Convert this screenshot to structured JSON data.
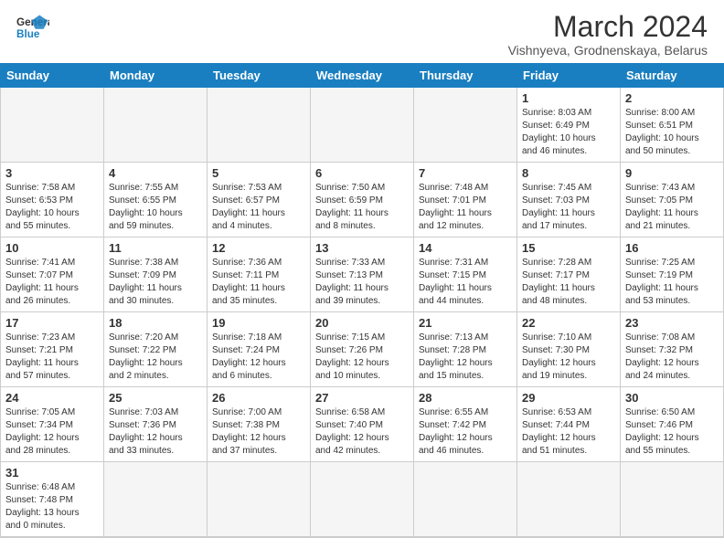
{
  "header": {
    "logo_general": "General",
    "logo_blue": "Blue",
    "month_title": "March 2024",
    "location": "Vishnyeva, Grodnenskaya, Belarus"
  },
  "weekdays": [
    "Sunday",
    "Monday",
    "Tuesday",
    "Wednesday",
    "Thursday",
    "Friday",
    "Saturday"
  ],
  "weeks": [
    [
      {
        "day": "",
        "info": ""
      },
      {
        "day": "",
        "info": ""
      },
      {
        "day": "",
        "info": ""
      },
      {
        "day": "",
        "info": ""
      },
      {
        "day": "",
        "info": ""
      },
      {
        "day": "1",
        "info": "Sunrise: 8:03 AM\nSunset: 6:49 PM\nDaylight: 10 hours\nand 46 minutes."
      },
      {
        "day": "2",
        "info": "Sunrise: 8:00 AM\nSunset: 6:51 PM\nDaylight: 10 hours\nand 50 minutes."
      }
    ],
    [
      {
        "day": "3",
        "info": "Sunrise: 7:58 AM\nSunset: 6:53 PM\nDaylight: 10 hours\nand 55 minutes."
      },
      {
        "day": "4",
        "info": "Sunrise: 7:55 AM\nSunset: 6:55 PM\nDaylight: 10 hours\nand 59 minutes."
      },
      {
        "day": "5",
        "info": "Sunrise: 7:53 AM\nSunset: 6:57 PM\nDaylight: 11 hours\nand 4 minutes."
      },
      {
        "day": "6",
        "info": "Sunrise: 7:50 AM\nSunset: 6:59 PM\nDaylight: 11 hours\nand 8 minutes."
      },
      {
        "day": "7",
        "info": "Sunrise: 7:48 AM\nSunset: 7:01 PM\nDaylight: 11 hours\nand 12 minutes."
      },
      {
        "day": "8",
        "info": "Sunrise: 7:45 AM\nSunset: 7:03 PM\nDaylight: 11 hours\nand 17 minutes."
      },
      {
        "day": "9",
        "info": "Sunrise: 7:43 AM\nSunset: 7:05 PM\nDaylight: 11 hours\nand 21 minutes."
      }
    ],
    [
      {
        "day": "10",
        "info": "Sunrise: 7:41 AM\nSunset: 7:07 PM\nDaylight: 11 hours\nand 26 minutes."
      },
      {
        "day": "11",
        "info": "Sunrise: 7:38 AM\nSunset: 7:09 PM\nDaylight: 11 hours\nand 30 minutes."
      },
      {
        "day": "12",
        "info": "Sunrise: 7:36 AM\nSunset: 7:11 PM\nDaylight: 11 hours\nand 35 minutes."
      },
      {
        "day": "13",
        "info": "Sunrise: 7:33 AM\nSunset: 7:13 PM\nDaylight: 11 hours\nand 39 minutes."
      },
      {
        "day": "14",
        "info": "Sunrise: 7:31 AM\nSunset: 7:15 PM\nDaylight: 11 hours\nand 44 minutes."
      },
      {
        "day": "15",
        "info": "Sunrise: 7:28 AM\nSunset: 7:17 PM\nDaylight: 11 hours\nand 48 minutes."
      },
      {
        "day": "16",
        "info": "Sunrise: 7:25 AM\nSunset: 7:19 PM\nDaylight: 11 hours\nand 53 minutes."
      }
    ],
    [
      {
        "day": "17",
        "info": "Sunrise: 7:23 AM\nSunset: 7:21 PM\nDaylight: 11 hours\nand 57 minutes."
      },
      {
        "day": "18",
        "info": "Sunrise: 7:20 AM\nSunset: 7:22 PM\nDaylight: 12 hours\nand 2 minutes."
      },
      {
        "day": "19",
        "info": "Sunrise: 7:18 AM\nSunset: 7:24 PM\nDaylight: 12 hours\nand 6 minutes."
      },
      {
        "day": "20",
        "info": "Sunrise: 7:15 AM\nSunset: 7:26 PM\nDaylight: 12 hours\nand 10 minutes."
      },
      {
        "day": "21",
        "info": "Sunrise: 7:13 AM\nSunset: 7:28 PM\nDaylight: 12 hours\nand 15 minutes."
      },
      {
        "day": "22",
        "info": "Sunrise: 7:10 AM\nSunset: 7:30 PM\nDaylight: 12 hours\nand 19 minutes."
      },
      {
        "day": "23",
        "info": "Sunrise: 7:08 AM\nSunset: 7:32 PM\nDaylight: 12 hours\nand 24 minutes."
      }
    ],
    [
      {
        "day": "24",
        "info": "Sunrise: 7:05 AM\nSunset: 7:34 PM\nDaylight: 12 hours\nand 28 minutes."
      },
      {
        "day": "25",
        "info": "Sunrise: 7:03 AM\nSunset: 7:36 PM\nDaylight: 12 hours\nand 33 minutes."
      },
      {
        "day": "26",
        "info": "Sunrise: 7:00 AM\nSunset: 7:38 PM\nDaylight: 12 hours\nand 37 minutes."
      },
      {
        "day": "27",
        "info": "Sunrise: 6:58 AM\nSunset: 7:40 PM\nDaylight: 12 hours\nand 42 minutes."
      },
      {
        "day": "28",
        "info": "Sunrise: 6:55 AM\nSunset: 7:42 PM\nDaylight: 12 hours\nand 46 minutes."
      },
      {
        "day": "29",
        "info": "Sunrise: 6:53 AM\nSunset: 7:44 PM\nDaylight: 12 hours\nand 51 minutes."
      },
      {
        "day": "30",
        "info": "Sunrise: 6:50 AM\nSunset: 7:46 PM\nDaylight: 12 hours\nand 55 minutes."
      }
    ],
    [
      {
        "day": "31",
        "info": "Sunrise: 6:48 AM\nSunset: 7:48 PM\nDaylight: 13 hours\nand 0 minutes."
      },
      {
        "day": "",
        "info": ""
      },
      {
        "day": "",
        "info": ""
      },
      {
        "day": "",
        "info": ""
      },
      {
        "day": "",
        "info": ""
      },
      {
        "day": "",
        "info": ""
      },
      {
        "day": "",
        "info": ""
      }
    ]
  ]
}
